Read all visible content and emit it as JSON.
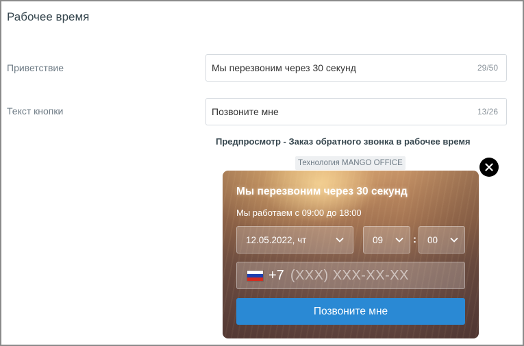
{
  "section": {
    "title": "Рабочее время"
  },
  "form": {
    "greeting": {
      "label": "Приветствие",
      "value": "Мы перезвоним через 30 секунд",
      "counter": "29/50"
    },
    "button_text": {
      "label": "Текст кнопки",
      "value": "Позвоните мне",
      "counter": "13/26"
    }
  },
  "preview": {
    "title": "Предпросмотр - Заказ обратного звонка в рабочее время",
    "powered_by": "Технология MANGO OFFICE",
    "close_icon": "close-icon",
    "widget": {
      "headline": "Мы перезвоним через 30 секунд",
      "hours": "Мы работаем с 09:00 до 18:00",
      "date": "12.05.2022, чт",
      "hour": "09",
      "time_separator": ":",
      "minute": "00",
      "phone_prefix": "+7",
      "phone_placeholder": "(XXX) XXX-XX-XX",
      "submit_label": "Позвоните мне",
      "flag_icon": "russia-flag-icon",
      "submit_color": "#2a89d4"
    }
  }
}
